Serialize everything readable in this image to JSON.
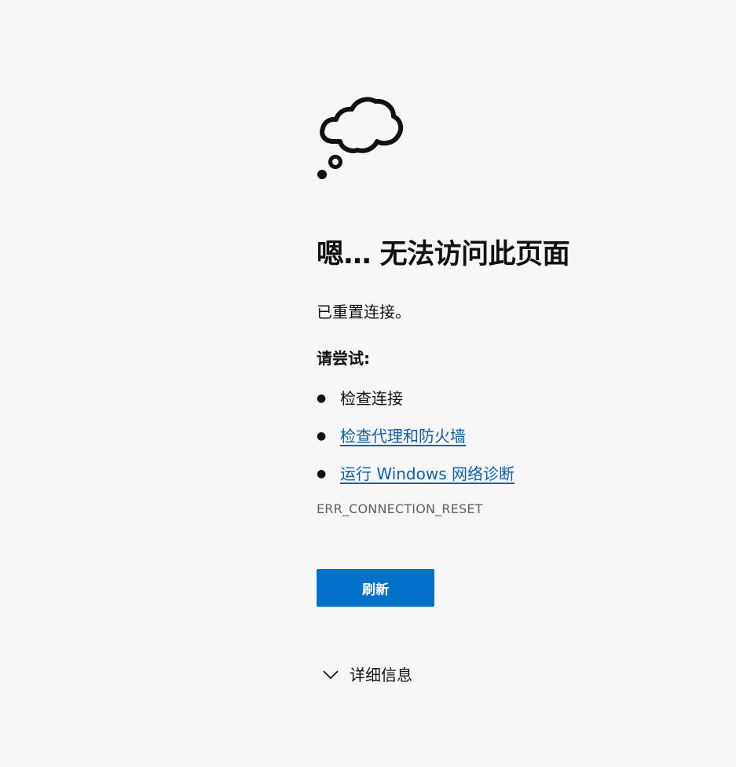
{
  "error_page": {
    "icon": "thought-cloud-icon",
    "heading": "嗯… 无法访问此页面",
    "subtitle": "已重置连接。",
    "try_heading": "请尝试:",
    "suggestions": [
      {
        "label": "检查连接",
        "is_link": false
      },
      {
        "label": "检查代理和防火墙",
        "is_link": true
      },
      {
        "label": "运行 Windows 网络诊断",
        "is_link": true
      }
    ],
    "error_code": "ERR_CONNECTION_RESET",
    "refresh_label": "刷新",
    "details_label": "详细信息",
    "details_icon": "chevron-down-icon"
  },
  "colors": {
    "background": "#f7f7f7",
    "link": "#0f5ea8",
    "button": "#0070c9",
    "error_code": "#5f5f5f"
  }
}
